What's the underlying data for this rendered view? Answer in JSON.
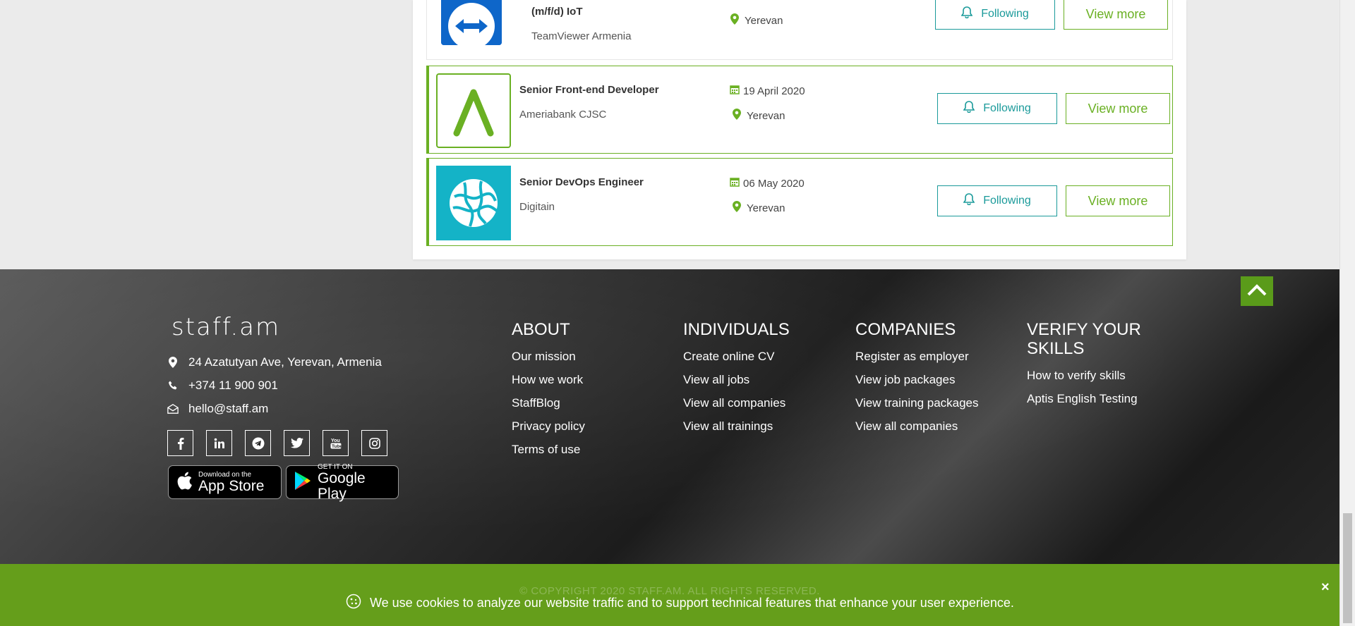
{
  "jobs": [
    {
      "title": "(m/f/d) IoT",
      "company": "TeamViewer Armenia",
      "location": "Yerevan",
      "follow_label": "Following",
      "view_label": "View more"
    },
    {
      "title": "Senior Front-end Developer",
      "company": "Ameriabank CJSC",
      "date": "19 April 2020",
      "location": "Yerevan",
      "follow_label": "Following",
      "view_label": "View more"
    },
    {
      "title": "Senior DevOps Engineer",
      "company": "Digitain",
      "date": "06 May 2020",
      "location": "Yerevan",
      "follow_label": "Following",
      "view_label": "View more"
    }
  ],
  "footer": {
    "logo": "staff.am",
    "address": "24 Azatutyan Ave, Yerevan, Armenia",
    "phone": "+374 11 900 901",
    "email": "hello@staff.am",
    "socials": [
      "facebook-icon",
      "linkedin-icon",
      "telegram-icon",
      "twitter-icon",
      "youtube-icon",
      "instagram-icon"
    ],
    "app_store": {
      "small": "Download on the",
      "big": "App Store"
    },
    "google_play": {
      "small": "GET IT ON",
      "big": "Google Play"
    },
    "columns": [
      {
        "heading": "ABOUT",
        "links": [
          "Our mission",
          "How we work",
          "StaffBlog",
          "Privacy policy",
          "Terms of use"
        ]
      },
      {
        "heading": "INDIVIDUALS",
        "links": [
          "Create online CV",
          "View all jobs",
          "View all companies",
          "View all trainings"
        ]
      },
      {
        "heading": "COMPANIES",
        "links": [
          "Register as employer",
          "View job packages",
          "View training packages",
          "View all companies"
        ]
      },
      {
        "heading": "VERIFY YOUR SKILLS",
        "links": [
          "How to verify skills",
          "Aptis English Testing"
        ]
      }
    ]
  },
  "cookie": {
    "copyright": "© COPYRIGHT 2020 STAFF.AM. ALL RIGHTS RESERVED.",
    "message": "We use cookies to analyze our website traffic and to support technical features that enhance your user experience.",
    "close": "×"
  },
  "colors": {
    "accent": "#6ab023",
    "teal": "#1a9a9a",
    "cookie_bar": "#659e1b",
    "to_top": "#5a9b1a"
  }
}
